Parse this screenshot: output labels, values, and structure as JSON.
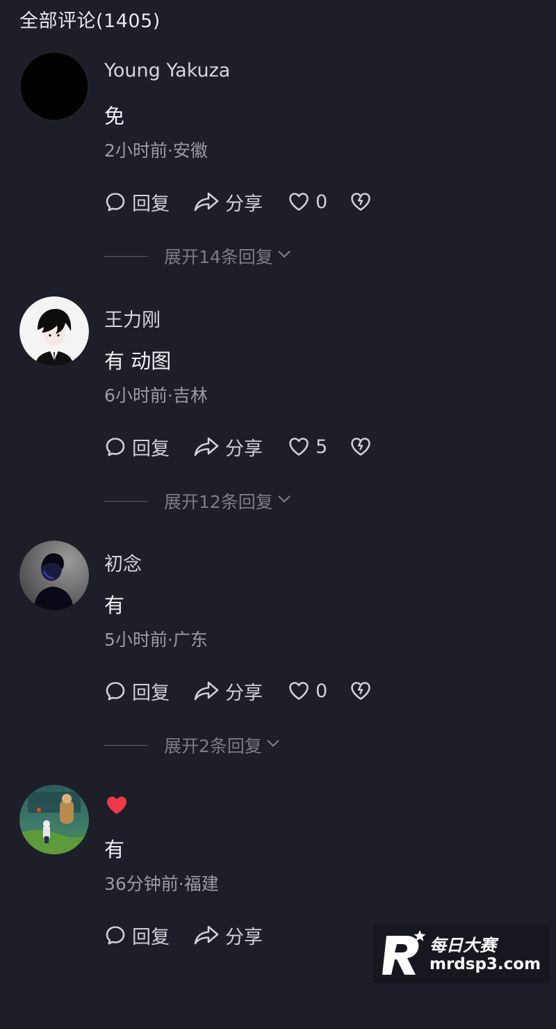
{
  "header": {
    "title": "全部评论(1405)"
  },
  "comments": [
    {
      "username": "Young Yakuza",
      "content": "免",
      "meta": "2小时前·安徽",
      "reply_label": "回复",
      "share_label": "分享",
      "likes": "0",
      "expand_label": "展开14条回复"
    },
    {
      "username": "王力刚",
      "content": "有 动图",
      "meta": "6小时前·吉林",
      "reply_label": "回复",
      "share_label": "分享",
      "likes": "5",
      "expand_label": "展开12条回复"
    },
    {
      "username": "初念",
      "content": "有",
      "meta": "5小时前·广东",
      "reply_label": "回复",
      "share_label": "分享",
      "likes": "0",
      "expand_label": "展开2条回复"
    },
    {
      "username_icon": "heart-icon",
      "content": "有",
      "meta": "36分钟前·福建",
      "reply_label": "回复",
      "share_label": "分享"
    }
  ],
  "watermark": {
    "brand": "每日大赛",
    "url": "mrdsp3.com"
  },
  "colors": {
    "background": "#1d1e27",
    "text_primary": "#f2f3f6",
    "text_secondary": "#9a9ca5",
    "heart_red": "#f0384d"
  }
}
